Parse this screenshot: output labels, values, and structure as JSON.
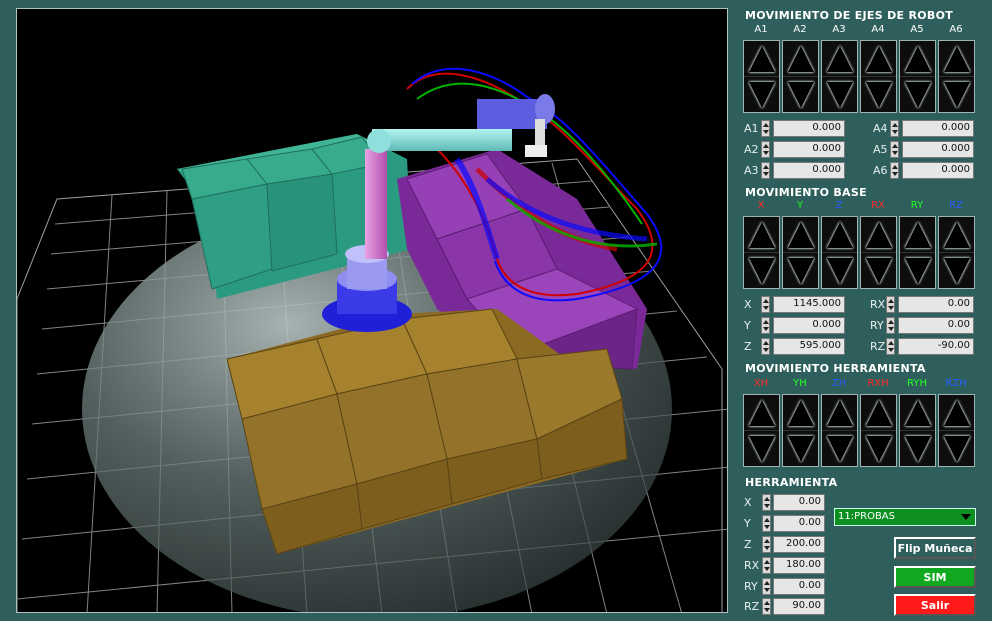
{
  "robot_axes": {
    "title": "MOVIMIENTO DE EJES DE ROBOT",
    "columns": [
      {
        "label": "A1",
        "color": "#ffffff"
      },
      {
        "label": "A2",
        "color": "#ffffff"
      },
      {
        "label": "A3",
        "color": "#ffffff"
      },
      {
        "label": "A4",
        "color": "#ffffff"
      },
      {
        "label": "A5",
        "color": "#ffffff"
      },
      {
        "label": "A6",
        "color": "#ffffff"
      }
    ],
    "fields": [
      {
        "label": "A1",
        "value": "0.000"
      },
      {
        "label": "A2",
        "value": "0.000"
      },
      {
        "label": "A3",
        "value": "0.000"
      },
      {
        "label": "A4",
        "value": "0.000"
      },
      {
        "label": "A5",
        "value": "0.000"
      },
      {
        "label": "A6",
        "value": "0.000"
      }
    ]
  },
  "base": {
    "title": "MOVIMIENTO BASE",
    "columns": [
      {
        "label": "X",
        "color": "#ff2a2a"
      },
      {
        "label": "Y",
        "color": "#22ff22"
      },
      {
        "label": "Z",
        "color": "#2a5cff"
      },
      {
        "label": "RX",
        "color": "#ff2a2a"
      },
      {
        "label": "RY",
        "color": "#22ff22"
      },
      {
        "label": "RZ",
        "color": "#2a5cff"
      }
    ],
    "fields": [
      {
        "label": "X",
        "value": "1145.000"
      },
      {
        "label": "Y",
        "value": "0.000"
      },
      {
        "label": "Z",
        "value": "595.000"
      },
      {
        "label": "RX",
        "value": "0.00"
      },
      {
        "label": "RY",
        "value": "0.00"
      },
      {
        "label": "RZ",
        "value": "-90.00"
      }
    ]
  },
  "tool_move": {
    "title": "MOVIMIENTO HERRAMIENTA",
    "columns": [
      {
        "label": "XH",
        "color": "#ff2a2a"
      },
      {
        "label": "YH",
        "color": "#22ff22"
      },
      {
        "label": "ZH",
        "color": "#2a5cff"
      },
      {
        "label": "RXH",
        "color": "#ff2a2a"
      },
      {
        "label": "RYH",
        "color": "#22ff22"
      },
      {
        "label": "RZH",
        "color": "#2a5cff"
      }
    ]
  },
  "tool": {
    "title": "HERRAMIENTA",
    "fields": [
      {
        "label": "X",
        "value": "0.00"
      },
      {
        "label": "Y",
        "value": "0.00"
      },
      {
        "label": "Z",
        "value": "200.00"
      },
      {
        "label": "RX",
        "value": "180.00"
      },
      {
        "label": "RY",
        "value": "0.00"
      },
      {
        "label": "RZ",
        "value": "90.00"
      }
    ],
    "selected_tool": "11:PROBAS"
  },
  "buttons": {
    "flip": "Flip Muñeca",
    "sim": "SIM",
    "exit": "Salir"
  },
  "colors": {
    "background": "#2f5f5c",
    "sim_button": "#12a81f",
    "exit_button": "#ff1a1a",
    "tool_dropdown": "#0e8f22"
  }
}
